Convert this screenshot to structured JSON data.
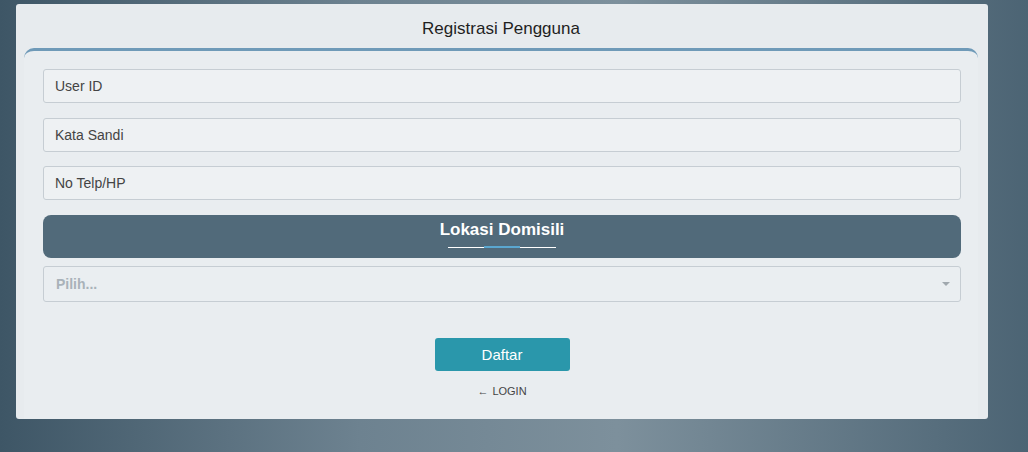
{
  "window": {
    "title": "Registrasi Pengguna"
  },
  "fields": [
    {
      "placeholder": "User ID"
    },
    {
      "placeholder": "Kata Sandi"
    },
    {
      "placeholder": "No Telp/HP"
    }
  ],
  "section": {
    "title": "Lokasi Domisili"
  },
  "select": {
    "placeholder": "Pilih..."
  },
  "buttons": [
    "Daftar"
  ],
  "login_link": {
    "arrow": "←",
    "label": "LOGIN"
  }
}
